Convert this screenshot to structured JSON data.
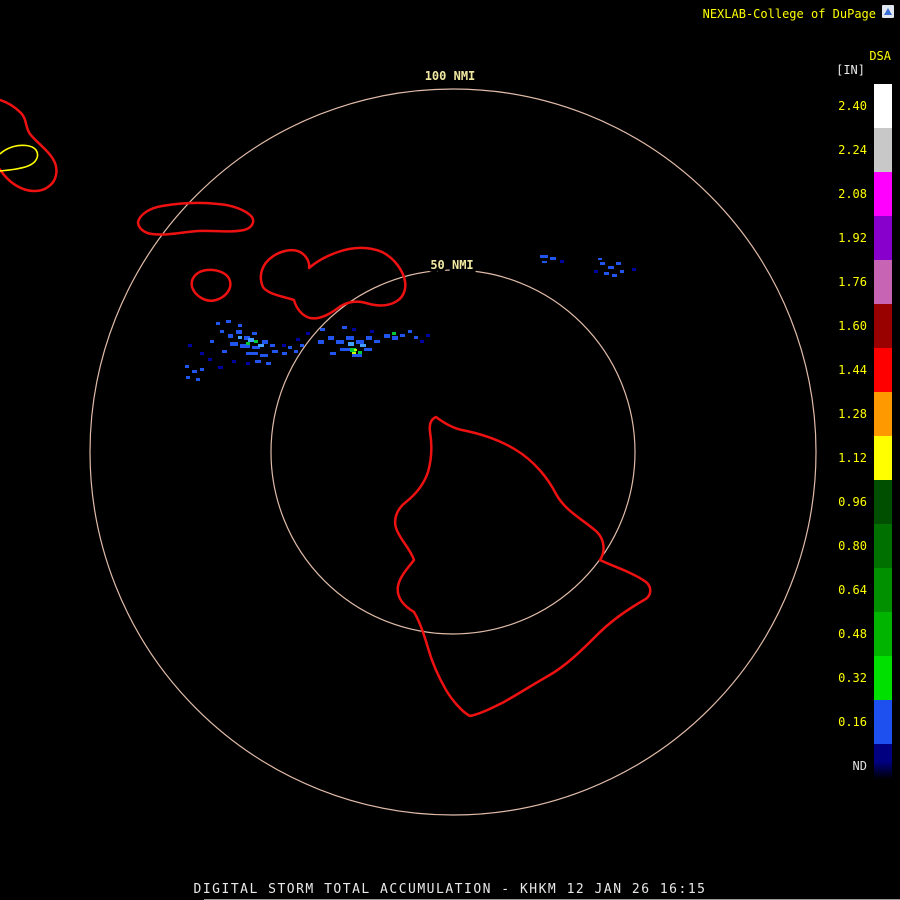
{
  "header": {
    "attribution": "NEXLAB-College of DuPage"
  },
  "scale": {
    "product": "DSA",
    "units": "[IN]",
    "label_color": "#ffff00",
    "nd_color": "#e0e0e0",
    "entries": [
      {
        "label": "2.40",
        "color": "#ffffff"
      },
      {
        "label": "2.24",
        "color": "#c8c8c8"
      },
      {
        "label": "2.08",
        "color": "#ff00ff"
      },
      {
        "label": "1.92",
        "color": "#8800cc"
      },
      {
        "label": "1.76",
        "color": "#c864b4"
      },
      {
        "label": "1.60",
        "color": "#990000"
      },
      {
        "label": "1.44",
        "color": "#ff0000"
      },
      {
        "label": "1.28",
        "color": "#ff9900"
      },
      {
        "label": "1.12",
        "color": "#ffff00"
      },
      {
        "label": "0.96",
        "color": "#004f00"
      },
      {
        "label": "0.80",
        "color": "#007000"
      },
      {
        "label": "0.64",
        "color": "#009000"
      },
      {
        "label": "0.48",
        "color": "#00b400"
      },
      {
        "label": "0.32",
        "color": "#00e000"
      },
      {
        "label": "0.16",
        "color": "#1e50f0"
      },
      {
        "label": "ND",
        "color": "#000080"
      }
    ]
  },
  "map": {
    "ring_color": "#e0bba8",
    "ring_label_color": "#f0e8a0",
    "outer_ring_label": "100 NMI",
    "inner_ring_label": "50 NMI",
    "island_color": "#ee1111",
    "county_line_color": "#ffff00",
    "echo_colors": {
      "blue": "#2255ee",
      "dark_blue": "#0000a0",
      "light_blue": "#44a0ff",
      "green": "#00c838",
      "bright": "#c8ff00"
    }
  },
  "footer": {
    "caption": "DIGITAL STORM TOTAL ACCUMULATION - KHKM 12 JAN 26 16:15"
  }
}
